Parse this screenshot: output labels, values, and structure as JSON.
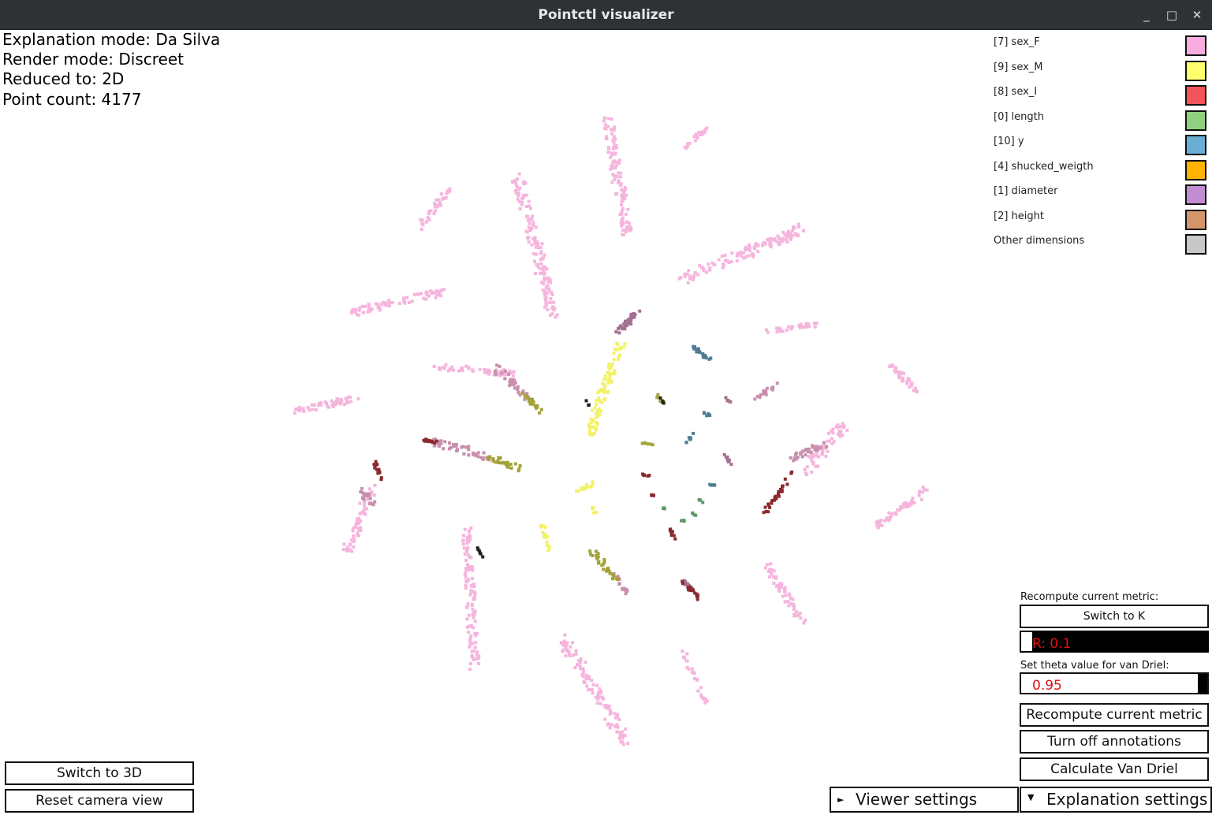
{
  "window": {
    "title": "Pointctl visualizer",
    "minimize": "_",
    "maximize": "□",
    "close": "✕"
  },
  "info": {
    "explanation_mode": "Explanation mode: Da Silva",
    "render_mode": "Render mode: Discreet",
    "reduced_to": "Reduced to: 2D",
    "point_count": "Point count: 4177"
  },
  "legend": [
    {
      "label": "[7] sex_F",
      "color": "#f7aede"
    },
    {
      "label": "[9] sex_M",
      "color": "#ffff6e"
    },
    {
      "label": "[8] sex_I",
      "color": "#f2545a"
    },
    {
      "label": "[0] length",
      "color": "#8fd17e"
    },
    {
      "label": "[10] y",
      "color": "#6aaed6"
    },
    {
      "label": "[4] shucked_weigth",
      "color": "#ffb300"
    },
    {
      "label": "[1] diameter",
      "color": "#c38bd0"
    },
    {
      "label": "[2] height",
      "color": "#d4956a"
    },
    {
      "label": "Other dimensions",
      "color": "#c8c8c8"
    }
  ],
  "controls": {
    "recompute_caption": "Recompute current metric:",
    "switch_k_label": "Switch to K",
    "r_value": "R: 0.1",
    "theta_caption": "Set theta value for van Driel:",
    "theta_value": "0.95",
    "recompute_button": "Recompute current metric",
    "annotations_button": "Turn off annotations",
    "van_driel_button": "Calculate Van Driel",
    "switch_3d_button": "Switch to 3D",
    "reset_camera_button": "Reset camera view",
    "viewer_settings": "Viewer settings",
    "explanation_settings": "Explanation settings"
  },
  "plot_colors": {
    "pink": "#f5b5dd",
    "mauve": "#c88fae",
    "dark_mauve": "#a4708f",
    "yellow": "#f2f26a",
    "olive": "#a3a33a",
    "maroon": "#8a2a2e",
    "steel_blue": "#4e7d95",
    "green": "#5f9a66",
    "dark": "#222222"
  }
}
